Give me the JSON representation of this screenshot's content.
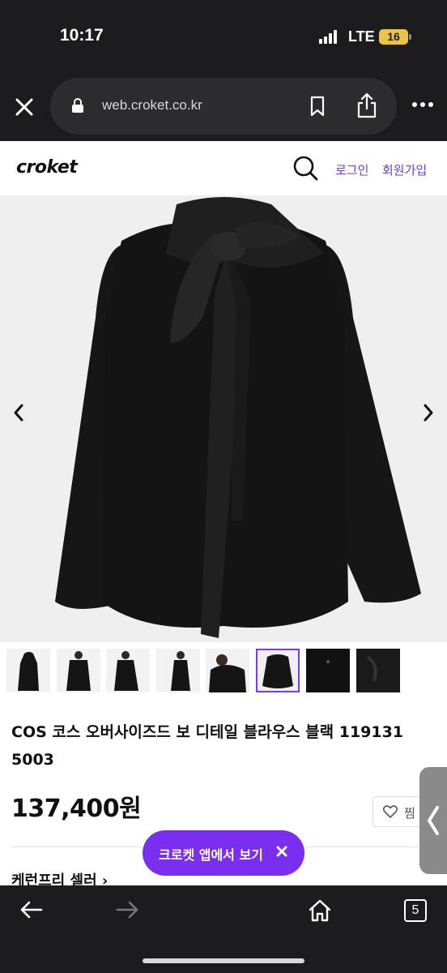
{
  "status_bar": {
    "time": "10:17",
    "network": "LTE",
    "battery": "16"
  },
  "browser": {
    "url": "web.croket.co.kr",
    "tab_count": "5"
  },
  "site": {
    "logo": "croket",
    "login": "로그인",
    "signup": "회원가입"
  },
  "product": {
    "title": "COS 코스 오버사이즈드 보 디테일 블라우스 블랙 119131 5003",
    "price": "137,400원",
    "like_label": "찜",
    "seller_label": "케런프리 셀러 ›",
    "thumbnail_count": 8,
    "active_thumbnail": 6
  },
  "app_banner": {
    "label": "크로켓 앱에서 보기"
  },
  "colors": {
    "accent": "#7a2ef0",
    "link": "#6b3fd0",
    "chrome": "#1c1c1e"
  },
  "icons": {
    "close": "close-icon",
    "lock": "lock-icon",
    "bookmark": "bookmark-icon",
    "share": "share-icon",
    "more": "more-icon",
    "search": "search-icon",
    "heart": "heart-icon",
    "back": "back-arrow-icon",
    "forward": "forward-arrow-icon",
    "home": "home-icon",
    "tabs": "tabs-icon"
  }
}
